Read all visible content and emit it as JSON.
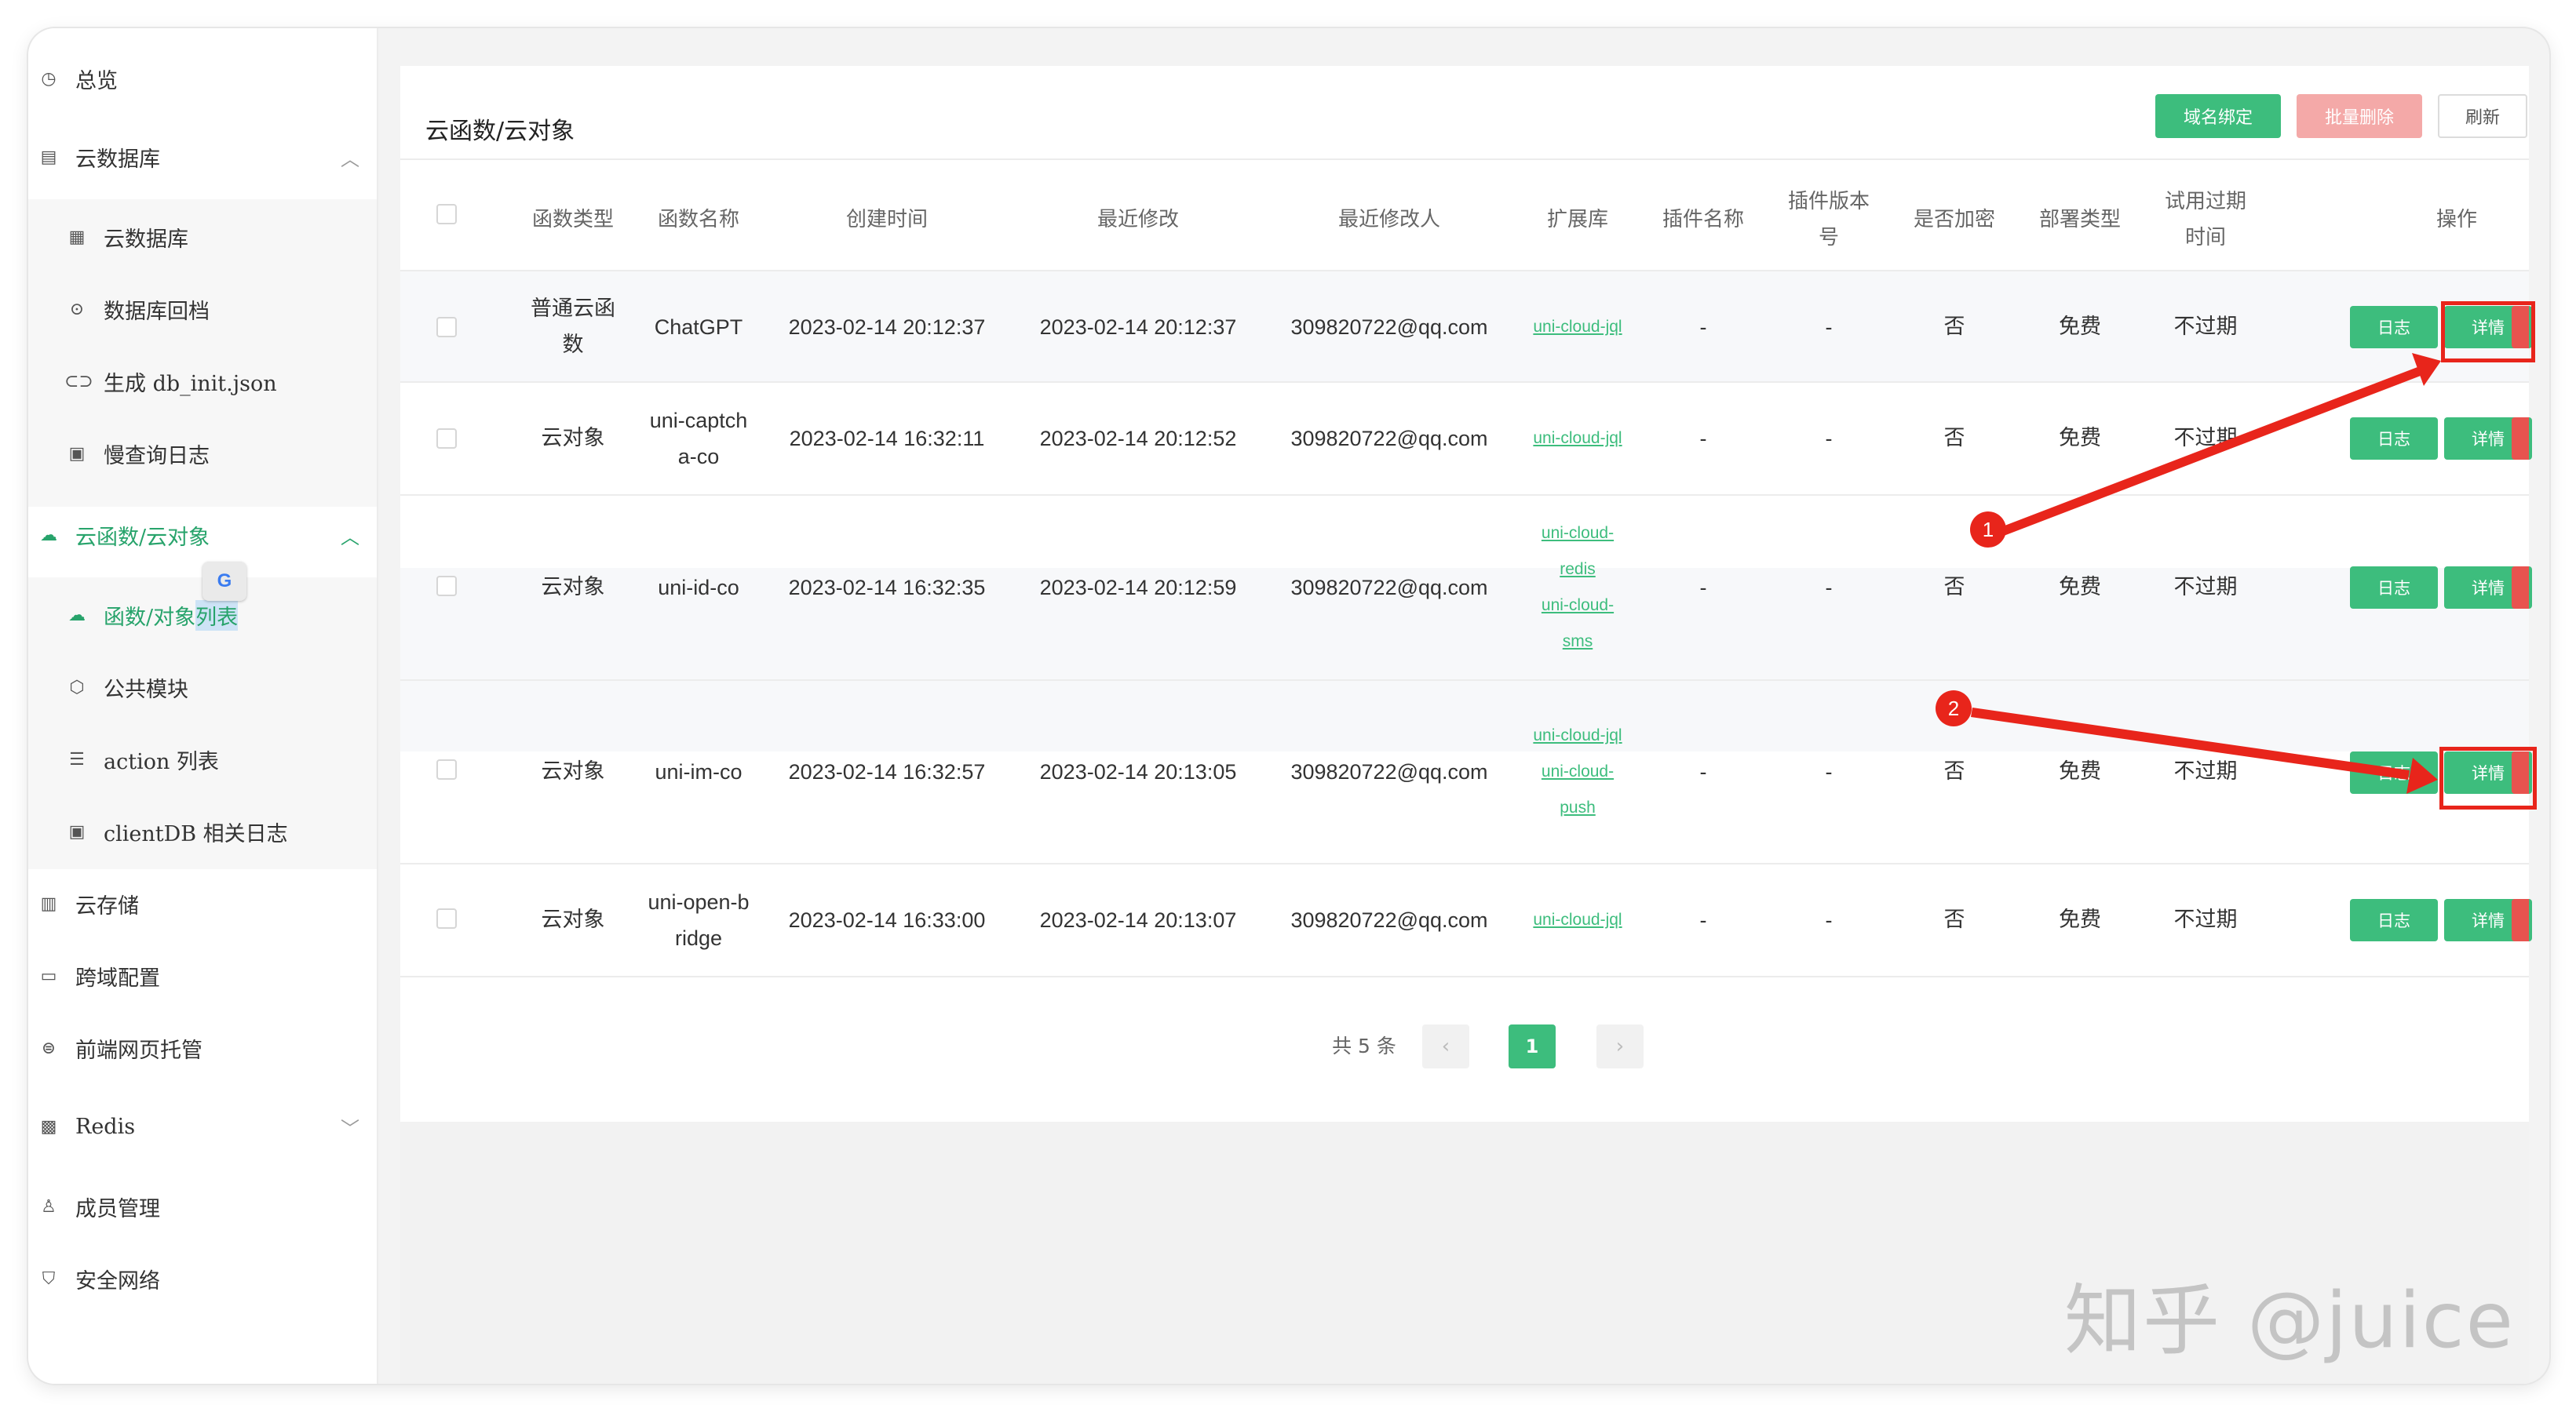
{
  "sidebar": {
    "items": [
      {
        "label": "总览",
        "icon": "clock-icon"
      },
      {
        "label": "云数据库",
        "icon": "database-icon"
      },
      {
        "label": "云数据库",
        "icon": "table-icon"
      },
      {
        "label": "数据库回档",
        "icon": "restore-icon"
      },
      {
        "label": "生成 db_init.json",
        "icon": "link-icon"
      },
      {
        "label": "慢查询日志",
        "icon": "log-icon"
      },
      {
        "label": "云函数/云对象",
        "icon": "cloud-icon"
      },
      {
        "label": "函数/对象",
        "label_highlight": "列表",
        "icon": "cloud-icon"
      },
      {
        "label": "公共模块",
        "icon": "cube-icon"
      },
      {
        "label": "action 列表",
        "icon": "list-icon"
      },
      {
        "label": "clientDB 相关日志",
        "icon": "log-icon"
      },
      {
        "label": "云存储",
        "icon": "storage-icon"
      },
      {
        "label": "跨域配置",
        "icon": "cors-icon"
      },
      {
        "label": "前端网页托管",
        "icon": "hosting-icon"
      },
      {
        "label": "Redis",
        "icon": "redis-icon"
      },
      {
        "label": "成员管理",
        "icon": "user-icon"
      },
      {
        "label": "安全网络",
        "icon": "shield-icon"
      }
    ],
    "translate_badge": "G"
  },
  "main": {
    "title": "云函数/云对象",
    "buttons": {
      "bind_domain": "域名绑定",
      "batch_delete": "批量删除",
      "refresh": "刷新"
    }
  },
  "table": {
    "headers": [
      "函数类型",
      "函数名称",
      "创建时间",
      "最近修改",
      "最近修改人",
      "扩展库",
      "插件名称",
      "插件版本号",
      "是否加密",
      "部署类型",
      "试用过期时间",
      "操作"
    ],
    "rows": [
      {
        "type": "普通云函数",
        "name": "ChatGPT",
        "created": "2023-02-14 20:12:37",
        "modified": "2023-02-14 20:12:37",
        "modifier": "309820722@qq.com",
        "ext": [
          "uni-cloud-jql"
        ],
        "plugin_name": "-",
        "plugin_version": "-",
        "encrypted": "否",
        "deploy": "免费",
        "trial": "不过期"
      },
      {
        "type": "云对象",
        "name": "uni-captcha-co",
        "created": "2023-02-14 16:32:11",
        "modified": "2023-02-14 20:12:52",
        "modifier": "309820722@qq.com",
        "ext": [
          "uni-cloud-jql"
        ],
        "plugin_name": "-",
        "plugin_version": "-",
        "encrypted": "否",
        "deploy": "免费",
        "trial": "不过期"
      },
      {
        "type": "云对象",
        "name": "uni-id-co",
        "created": "2023-02-14 16:32:35",
        "modified": "2023-02-14 20:12:59",
        "modifier": "309820722@qq.com",
        "ext": [
          "uni-cloud-redis",
          "uni-cloud-sms"
        ],
        "plugin_name": "-",
        "plugin_version": "-",
        "encrypted": "否",
        "deploy": "免费",
        "trial": "不过期"
      },
      {
        "type": "云对象",
        "name": "uni-im-co",
        "created": "2023-02-14 16:32:57",
        "modified": "2023-02-14 20:13:05",
        "modifier": "309820722@qq.com",
        "ext": [
          "uni-cloud-jql",
          "uni-cloud-push"
        ],
        "plugin_name": "-",
        "plugin_version": "-",
        "encrypted": "否",
        "deploy": "免费",
        "trial": "不过期"
      },
      {
        "type": "云对象",
        "name": "uni-open-bridge",
        "created": "2023-02-14 16:33:00",
        "modified": "2023-02-14 20:13:07",
        "modifier": "309820722@qq.com",
        "ext": [
          "uni-cloud-jql"
        ],
        "plugin_name": "-",
        "plugin_version": "-",
        "encrypted": "否",
        "deploy": "免费",
        "trial": "不过期"
      }
    ],
    "action_log": "日志",
    "action_detail": "详情"
  },
  "pagination": {
    "total": "共 5 条",
    "prev": "‹",
    "current": "1",
    "next": "›"
  },
  "annotations": {
    "badge_1": "1",
    "badge_2": "2",
    "color": "#e8251b"
  },
  "watermark": "知乎 @juice",
  "colors": {
    "accent": "#3dbd7d",
    "danger_light": "#f4a9a8",
    "danger": "#e8534f"
  }
}
